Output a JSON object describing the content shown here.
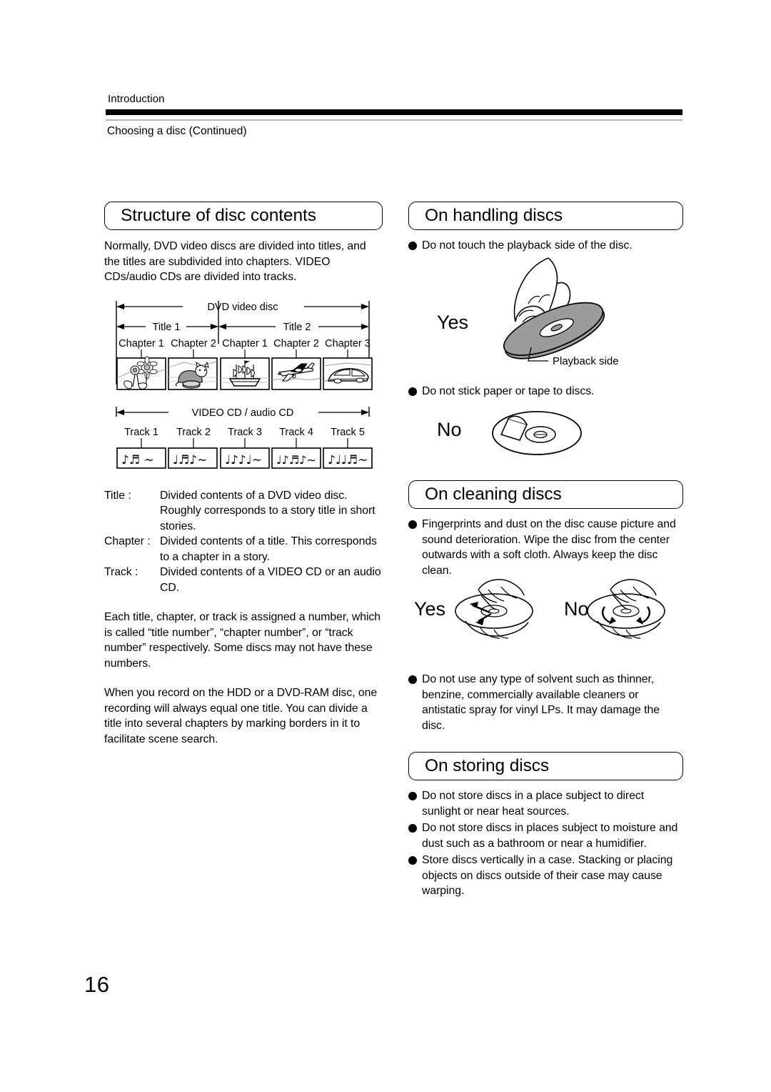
{
  "header": {
    "kicker": "Introduction",
    "subkicker": "Choosing a disc (Continued)"
  },
  "page_number": "16",
  "left_column": {
    "section": {
      "title": "Structure of disc contents"
    },
    "intro": "Normally, DVD video discs are divided into titles, and the titles are subdivided into chapters. VIDEO CDs/audio CDs are divided into tracks.",
    "dvd_diagram": {
      "top_label": "DVD video disc",
      "titles": [
        "Title 1",
        "Title 2"
      ],
      "chapters": [
        "Chapter 1",
        "Chapter 2",
        "Chapter 1",
        "Chapter 2",
        "Chapter 3"
      ],
      "thumbnails": [
        "sunflowers",
        "cat",
        "sailing-ship",
        "airplane",
        "car"
      ]
    },
    "cd_diagram": {
      "top_label": "VIDEO CD / audio CD",
      "tracks": [
        "Track 1",
        "Track 2",
        "Track 3",
        "Track 4",
        "Track 5"
      ]
    },
    "definitions": [
      {
        "term": "Title :",
        "desc": "Divided contents of a DVD video disc. Roughly corresponds to a story title in short stories."
      },
      {
        "term": "Chapter :",
        "desc": "Divided contents of a title. This corresponds to a chapter in a story."
      },
      {
        "term": "Track :",
        "desc": "Divided contents of a VIDEO CD or an audio CD."
      }
    ],
    "note_numbers": "Each title, chapter, or track is assigned a number, which is called “title number”, “chapter number”, or “track number” respectively. Some discs may not have these numbers.",
    "note_recording": "When you record on the HDD or a DVD-RAM disc, one recording will always equal one title. You can divide a title into several chapters by marking borders in it to facilitate scene search."
  },
  "right_column": {
    "handling": {
      "title": "On handling discs",
      "bullets": [
        "Do not touch the playback side of the disc.",
        "Do not stick paper or tape to discs."
      ],
      "yes_label": "Yes",
      "no_label": "No",
      "callout": "Playback side"
    },
    "cleaning": {
      "title": "On cleaning discs",
      "bullets": [
        "Fingerprints and dust on the disc cause picture and sound deterioration. Wipe the disc from the center outwards with a soft cloth. Always keep the disc clean.",
        "Do not use any type of solvent such as thinner, benzine, commercially available cleaners or antistatic spray for vinyl LPs. It may damage the disc."
      ],
      "yes_label": "Yes",
      "no_label": "No"
    },
    "storing": {
      "title": "On storing discs",
      "bullets": [
        "Do not store discs in a place subject to direct sunlight or near heat sources.",
        "Do not store discs in places subject to moisture and dust such as a bathroom or near a humidifier.",
        "Store discs vertically in a case. Stacking or placing objects on discs outside of their case may cause warping."
      ]
    }
  }
}
